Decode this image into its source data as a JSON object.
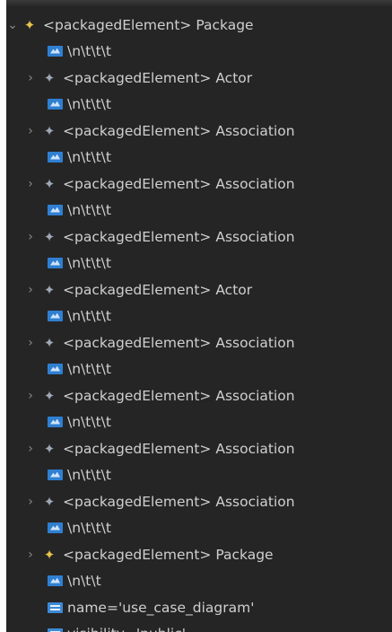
{
  "tree": {
    "root": {
      "chevron": "⌄",
      "icon": "star-icon",
      "label": "<packagedElement> Package"
    },
    "rows": [
      {
        "kind": "text",
        "label": "\\n\\t\\t\\t"
      },
      {
        "kind": "element",
        "chevron": "›",
        "label": "<packagedElement> Actor"
      },
      {
        "kind": "text",
        "label": "\\n\\t\\t\\t"
      },
      {
        "kind": "element",
        "chevron": "›",
        "label": "<packagedElement> Association"
      },
      {
        "kind": "text",
        "label": "\\n\\t\\t\\t"
      },
      {
        "kind": "element",
        "chevron": "›",
        "label": "<packagedElement> Association"
      },
      {
        "kind": "text",
        "label": "\\n\\t\\t\\t"
      },
      {
        "kind": "element",
        "chevron": "›",
        "label": "<packagedElement> Association"
      },
      {
        "kind": "text",
        "label": "\\n\\t\\t\\t"
      },
      {
        "kind": "element",
        "chevron": "›",
        "label": "<packagedElement> Actor"
      },
      {
        "kind": "text",
        "label": "\\n\\t\\t\\t"
      },
      {
        "kind": "element",
        "chevron": "›",
        "label": "<packagedElement> Association"
      },
      {
        "kind": "text",
        "label": "\\n\\t\\t\\t"
      },
      {
        "kind": "element",
        "chevron": "›",
        "label": "<packagedElement> Association"
      },
      {
        "kind": "text",
        "label": "\\n\\t\\t\\t"
      },
      {
        "kind": "element",
        "chevron": "›",
        "label": "<packagedElement> Association"
      },
      {
        "kind": "text",
        "label": "\\n\\t\\t\\t"
      },
      {
        "kind": "element",
        "chevron": "›",
        "label": "<packagedElement> Association"
      },
      {
        "kind": "text",
        "label": "\\n\\t\\t\\t"
      },
      {
        "kind": "package",
        "chevron": "›",
        "label": "<packagedElement> Package"
      },
      {
        "kind": "text",
        "label": "\\n\\t\\t"
      },
      {
        "kind": "attr",
        "label": "name='use_case_diagram'"
      },
      {
        "kind": "attr",
        "label": "visibility='public'"
      }
    ]
  },
  "colors": {
    "panel_bg": "#252526",
    "text": "#cccccc",
    "package_star": "#e8c24a",
    "element_star": "#9da7b5",
    "text_node_icon": "#2f7fd1"
  }
}
